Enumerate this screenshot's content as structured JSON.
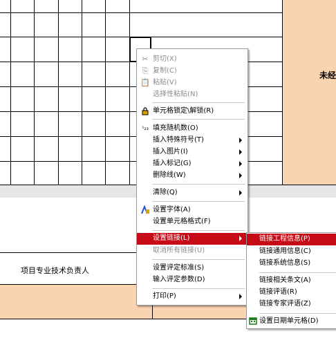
{
  "sheet": {
    "right_label": "未经",
    "row_label": "项目专业技术负责人"
  },
  "context_menu": {
    "items": [
      {
        "label": "剪切(X)",
        "icon": "scissors-icon",
        "disabled": true
      },
      {
        "label": "复制(C)",
        "icon": "copy-icon",
        "disabled": true
      },
      {
        "label": "粘贴(V)",
        "icon": "paste-icon",
        "disabled": true
      },
      {
        "label": "选择性粘贴(N)",
        "disabled": true
      },
      {
        "label": "单元格锁定\\解锁(R)",
        "icon": "lock-icon"
      },
      {
        "label": "填充随机数(O)",
        "icon": "random-number-icon"
      },
      {
        "label": "插入特殊符号(T)",
        "submenu": true
      },
      {
        "label": "插入图片(I)",
        "submenu": true
      },
      {
        "label": "插入标记(G)",
        "submenu": true
      },
      {
        "label": "删除线(W)",
        "submenu": true
      },
      {
        "label": "清除(Q)",
        "submenu": true
      },
      {
        "label": "设置字体(A)",
        "icon": "font-icon"
      },
      {
        "label": "设置单元格格式(F)"
      },
      {
        "label": "设置链接(L)",
        "submenu": true,
        "highlighted": true
      },
      {
        "label": "取消所有链接(U)",
        "disabled": true
      },
      {
        "label": "设置评定标准(S)"
      },
      {
        "label": "输入评定参数(D)"
      },
      {
        "label": "打印(P)",
        "submenu": true
      }
    ]
  },
  "submenu": {
    "items": [
      {
        "label": "链接工程信息(P)",
        "highlighted": true
      },
      {
        "label": "链接通用信息(C)"
      },
      {
        "label": "链接系统信息(S)"
      },
      {
        "label": "链接相关条文(A)"
      },
      {
        "label": "链接评语(R)"
      },
      {
        "label": "链接专家评语(Z)"
      },
      {
        "label": "设置日期单元格(D)",
        "icon": "calendar-icon"
      }
    ]
  },
  "colors": {
    "highlight": "#c60a16",
    "peach_cell": "#fad3b1",
    "disabled_text": "#8c8c8c"
  }
}
